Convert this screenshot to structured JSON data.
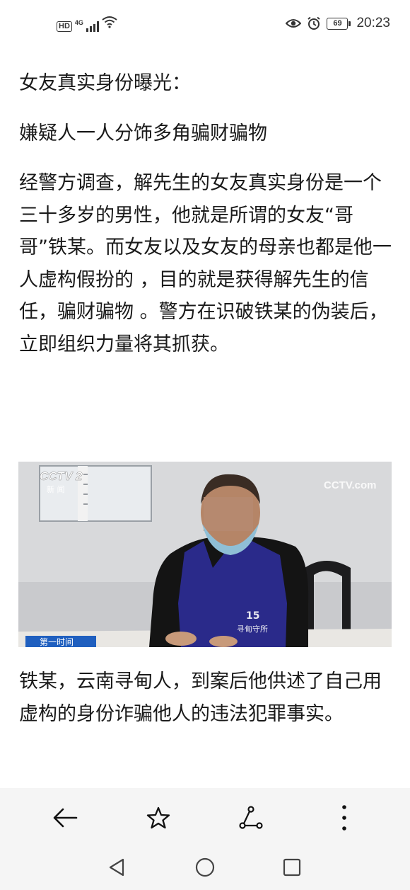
{
  "status_bar": {
    "hd_label": "HD",
    "network_label": "4G",
    "battery_level": "69",
    "time": "20:23"
  },
  "article": {
    "heading": "女友真实身份曝光：",
    "subheading": "嫌疑人一人分饰多角骗财骗物",
    "body": "经警方调查，解先生的女友真实身份是一个三十多岁的男性，他就是所谓的女友“哥哥”铁某。而女友以及女友的母亲也都是他一人虚构假扮的 ，目的就是获得解先生的信任，骗财骗物 。警方在识破铁某的伪装后，立即组织力量将其抓获。",
    "caption": "铁某，云南寻甸人，到案后他供述了自己用虚构的身份诈骗他人的违法犯罪事实。"
  },
  "photo": {
    "channel_logo": "CCTV 2",
    "channel_sub": "新 闻",
    "watermark": "CCTV.com",
    "program_tag": "第一时间",
    "vest_number": "15",
    "vest_text": "寻甸守所"
  },
  "toolbar": {
    "back_icon": "arrow-left-icon",
    "favorite_icon": "star-icon",
    "share_icon": "share-icon",
    "more_icon": "more-vertical-icon"
  },
  "nav": {
    "back_icon": "triangle-back-icon",
    "home_icon": "circle-home-icon",
    "recents_icon": "square-recents-icon"
  },
  "colors": {
    "text": "#1a1a1a",
    "toolbar_bg": "#f5f5f5",
    "vest": "#2a2a8a",
    "tag": "#1f5fbf"
  }
}
